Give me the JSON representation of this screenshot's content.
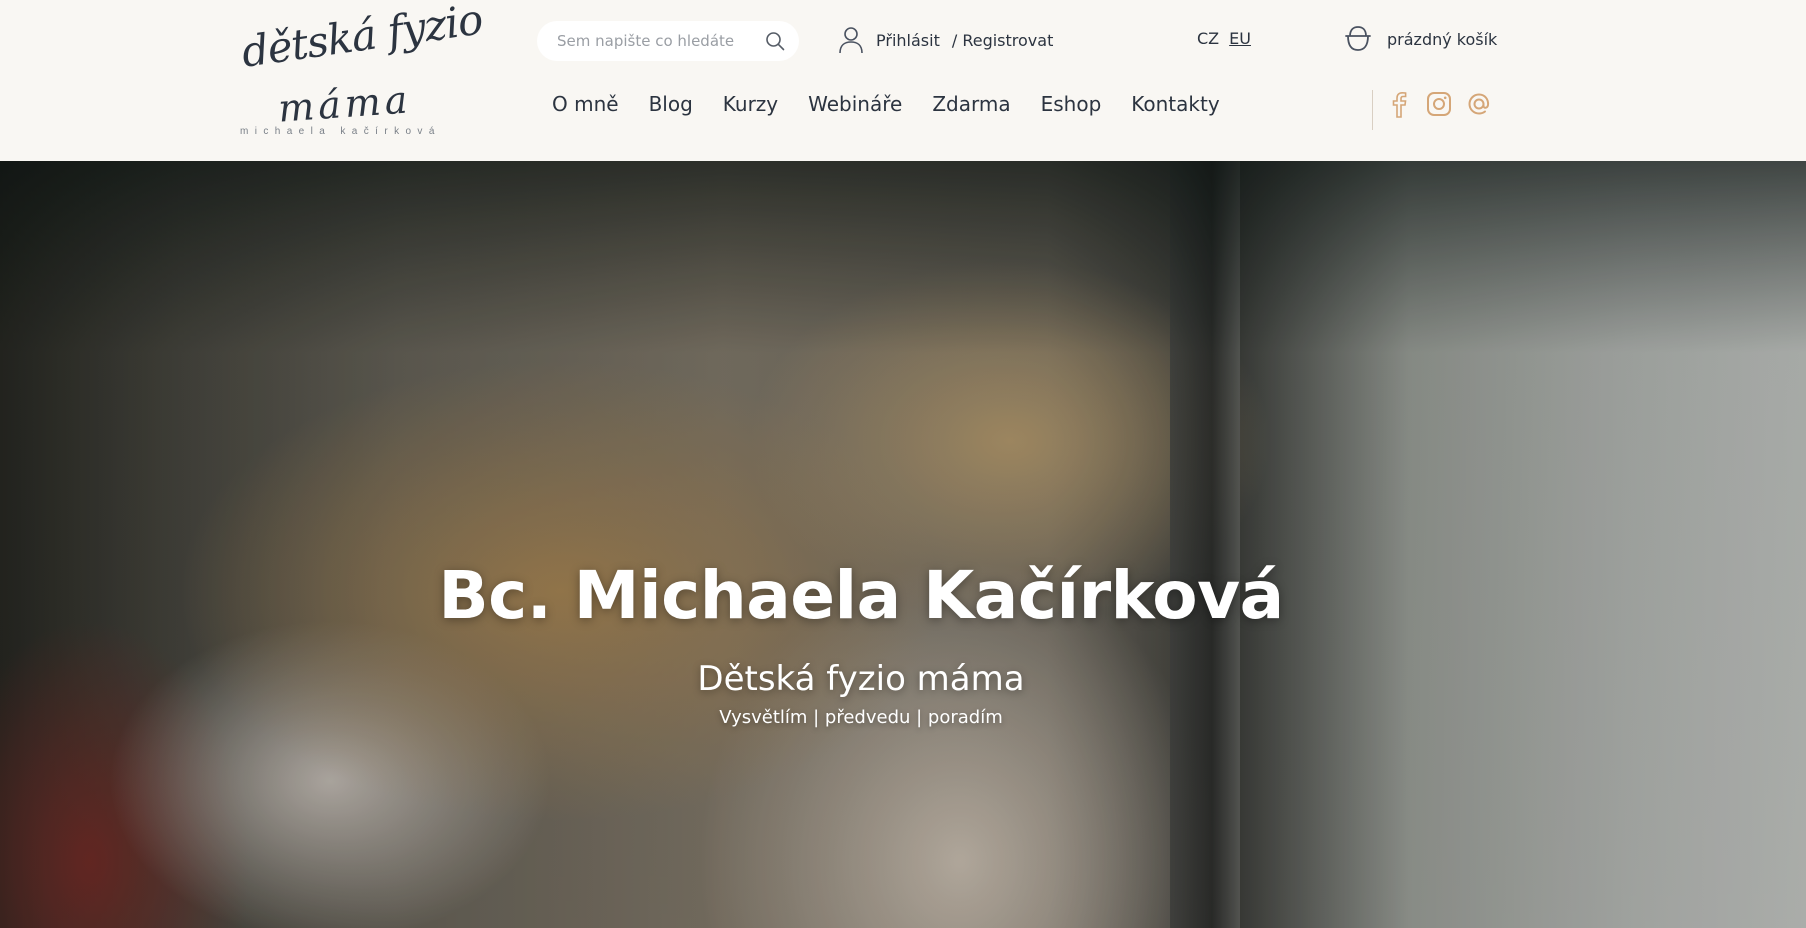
{
  "logo": {
    "line1": "dětská fyzio",
    "line2": "máma",
    "line3": "michaela kačírková"
  },
  "search": {
    "placeholder": "Sem napište co hledáte",
    "icon": "search-icon"
  },
  "account": {
    "login_label": "Přihlásit",
    "register_label": "/ Registrovat",
    "icon": "user-icon"
  },
  "languages": {
    "cz": "CZ",
    "eu": "EU"
  },
  "cart": {
    "label": "prázdný košík",
    "icon": "cart-icon"
  },
  "nav": {
    "items": [
      {
        "label": "O mně"
      },
      {
        "label": "Blog"
      },
      {
        "label": "Kurzy"
      },
      {
        "label": "Webináře"
      },
      {
        "label": "Zdarma"
      },
      {
        "label": "Eshop"
      },
      {
        "label": "Kontakty"
      }
    ]
  },
  "social": {
    "icons": [
      "facebook-icon",
      "instagram-icon",
      "email-icon"
    ],
    "color": "#d5a677"
  },
  "hero": {
    "title": "Bc. Michaela Kačírková",
    "subtitle": "Dětská fyzio máma",
    "tagline": "Vysvětlím | předvedu | poradím"
  },
  "colors": {
    "header_bg": "#f9f7f3",
    "text": "#2c3440",
    "accent": "#d5a677"
  }
}
